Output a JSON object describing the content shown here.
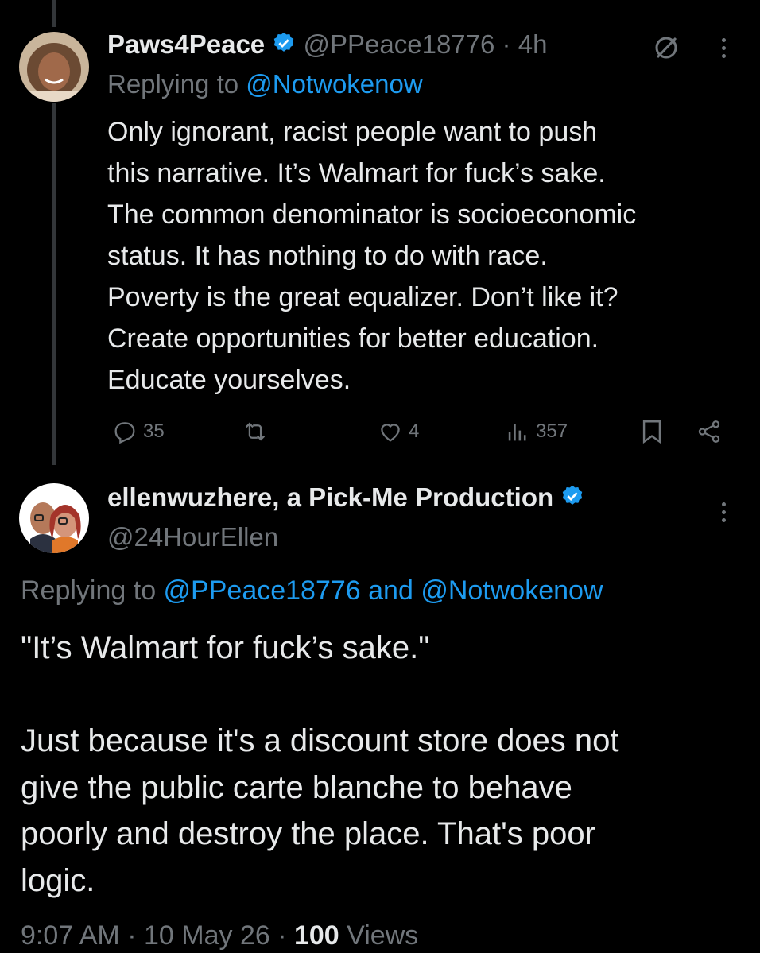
{
  "tweet1": {
    "display_name": "Paws4Peace",
    "handle": "@PPeace18776",
    "separator": "·",
    "time": "4h",
    "replying_prefix": "Replying to ",
    "replying_to": "@Notwokenow",
    "text_lines": [
      "Only ignorant, racist people want to push",
      "this narrative. It’s Walmart for fuck’s sake.",
      "The common denominator is socioeconomic",
      "status. It has nothing to do with race.",
      "Poverty is the great equalizer. Don’t like it?",
      "Create opportunities for better education.",
      "Educate yourselves."
    ],
    "actions": {
      "replies": "35",
      "reposts": "",
      "likes": "4",
      "views": "357"
    },
    "icons": [
      "verified-icon",
      "grok-icon",
      "more-icon",
      "reply-icon",
      "repost-icon",
      "like-icon",
      "views-icon",
      "bookmark-icon",
      "share-icon"
    ]
  },
  "tweet2": {
    "display_name": "ellenwuzhere, a Pick-Me Production",
    "handle": "@24HourEllen",
    "replying_prefix": "Replying to ",
    "replying_to_1": "@PPeace18776",
    "replying_and": " and ",
    "replying_to_2": "@Notwokenow",
    "text_lines": [
      "\"It’s Walmart for fuck’s sake.\"",
      "",
      "Just because it's a discount store does not",
      "give the public carte blanche to behave",
      "poorly and destroy the place. That's poor",
      "logic."
    ],
    "timestamp_time": "9:07 AM",
    "timestamp_sep1": "·",
    "timestamp_date": "10 May 26",
    "timestamp_sep2": "·",
    "views_count": "100",
    "views_label": "Views"
  },
  "colors": {
    "background": "#000000",
    "text": "#e7e9ea",
    "secondary": "#71767b",
    "link": "#1d9bf0",
    "thread_line": "#333639"
  }
}
